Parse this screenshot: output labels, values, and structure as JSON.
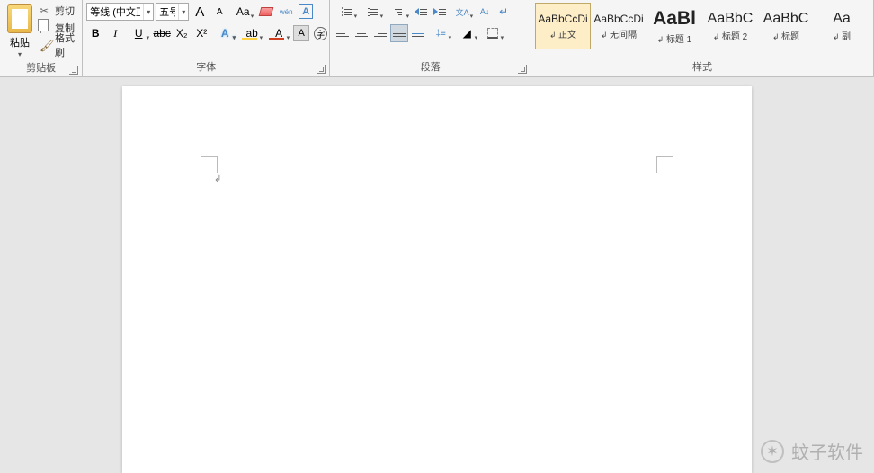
{
  "clipboard": {
    "paste": "粘贴",
    "cut": "剪切",
    "copy": "复制",
    "format_painter": "格式刷",
    "group_label": "剪贴板"
  },
  "font": {
    "family": "等线 (中文正",
    "size": "五号",
    "grow": "A",
    "shrink": "A",
    "case": "Aa",
    "phonetic": "wén",
    "bold": "B",
    "italic": "I",
    "underline": "U",
    "strike": "abc",
    "subscript": "X₂",
    "superscript": "X²",
    "text_effect": "A",
    "highlight": "ab",
    "font_color": "A",
    "char_shading": "A",
    "char_border": "A",
    "group_label": "字体"
  },
  "paragraph": {
    "group_label": "段落"
  },
  "styles": {
    "group_label": "样式",
    "items": [
      {
        "preview": "AaBbCcDi",
        "name": "正文",
        "cls": "",
        "selected": true
      },
      {
        "preview": "AaBbCcDi",
        "name": "无间隔",
        "cls": "",
        "selected": false
      },
      {
        "preview": "AaBl",
        "name": "标题 1",
        "cls": "big",
        "selected": false
      },
      {
        "preview": "AaBbC",
        "name": "标题 2",
        "cls": "med",
        "selected": false
      },
      {
        "preview": "AaBbC",
        "name": "标题",
        "cls": "med",
        "selected": false
      },
      {
        "preview": "Aa",
        "name": "副",
        "cls": "med",
        "selected": false
      }
    ]
  },
  "watermark": {
    "text": "蚊子软件"
  }
}
